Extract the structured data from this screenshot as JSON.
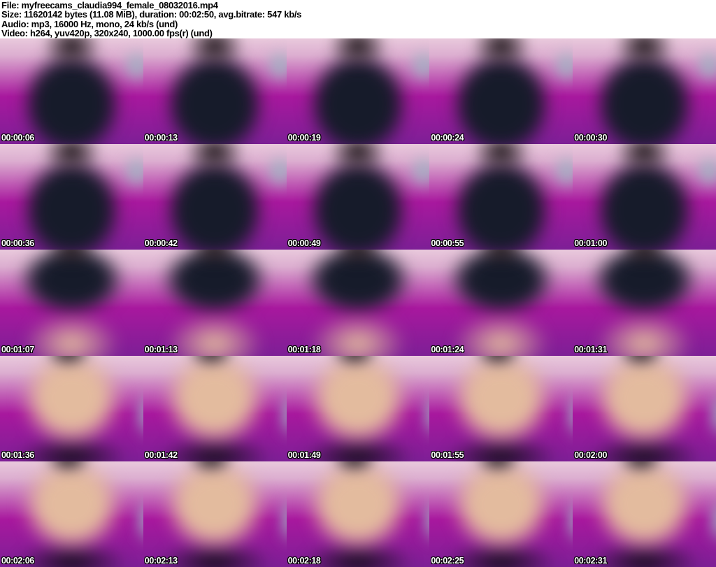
{
  "header": {
    "lines": [
      "File: myfreecams_claudia994_female_08032016.mp4",
      "Size: 11620142 bytes (11.08 MiB), duration: 00:02:50, avg.bitrate: 547 kb/s",
      "Audio: mp3, 16000 Hz, mono, 24 kb/s (und)",
      "Video: h264, yuv420p, 320x240, 1000.00 fps(r) (und)"
    ]
  },
  "grid": {
    "columns": 5,
    "rows": 5,
    "timestamps": [
      "00:00:06",
      "00:00:13",
      "00:00:19",
      "00:00:24",
      "00:00:30",
      "00:00:36",
      "00:00:42",
      "00:00:49",
      "00:00:55",
      "00:01:00",
      "00:01:07",
      "00:01:13",
      "00:01:18",
      "00:01:24",
      "00:01:31",
      "00:01:36",
      "00:01:42",
      "00:01:49",
      "00:01:55",
      "00:02:00",
      "00:02:06",
      "00:02:13",
      "00:02:18",
      "00:02:25",
      "00:02:31"
    ]
  },
  "colors": {
    "header_bg": "#ffffff",
    "header_text": "#000000",
    "timestamp_text": "#ffffff",
    "timestamp_outline": "#000000",
    "room_magenta": "#a8189e",
    "room_purple": "#7d1f96",
    "wallpaper_pink": "#e9c9dc",
    "shirt_navy": "#161b2a",
    "hair_dark": "#1a1216",
    "skin_tan": "#e3bb9e",
    "garment_black": "#0d0d12",
    "curtain_teal": "#9db8c3"
  }
}
